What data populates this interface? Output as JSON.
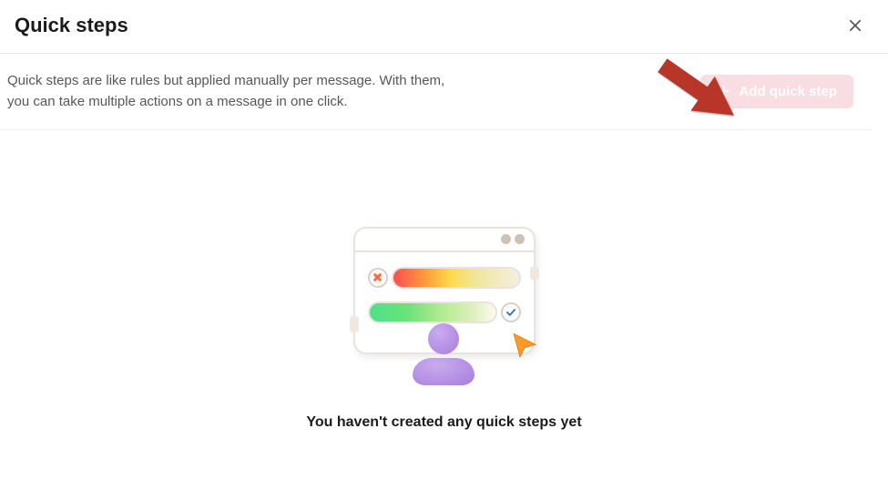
{
  "header": {
    "title": "Quick steps"
  },
  "description": {
    "line1": "Quick steps are like rules but applied manually per message. With them,",
    "line2": "you can take multiple actions on a message in one click."
  },
  "actions": {
    "add_label": "Add quick step"
  },
  "empty_state": {
    "message": "You haven't created any quick steps yet"
  }
}
